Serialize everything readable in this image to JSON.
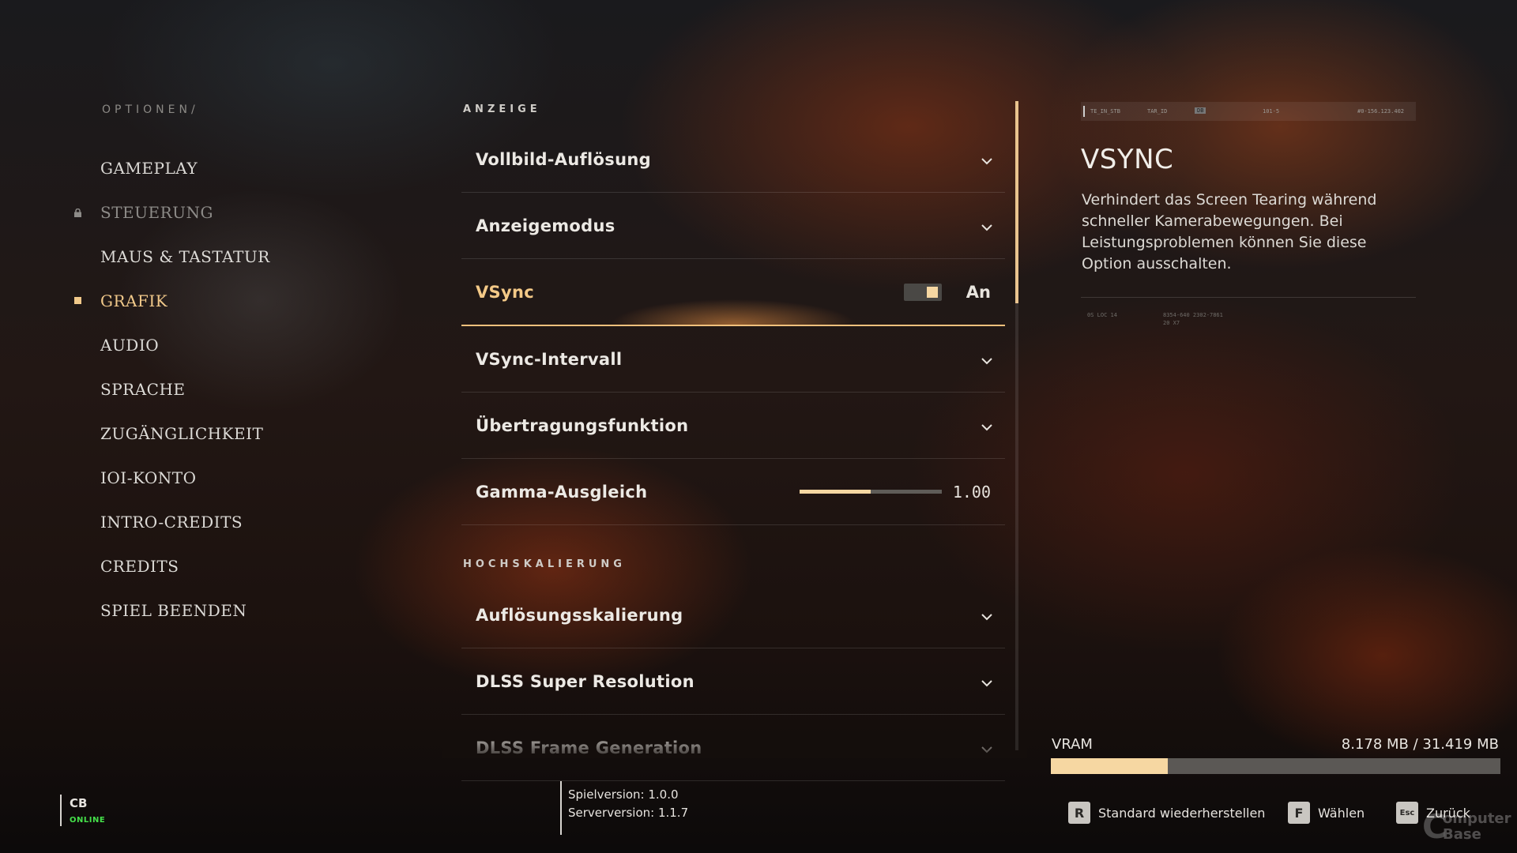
{
  "breadcrumb": "OPTIONEN/",
  "nav": {
    "items": [
      {
        "label": "GAMEPLAY",
        "state": "normal"
      },
      {
        "label": "STEUERUNG",
        "state": "locked",
        "icon": "lock-icon"
      },
      {
        "label": "MAUS & TASTATUR",
        "state": "normal"
      },
      {
        "label": "GRAFIK",
        "state": "active",
        "icon": "square-marker-icon"
      },
      {
        "label": "AUDIO",
        "state": "normal"
      },
      {
        "label": "SPRACHE",
        "state": "normal"
      },
      {
        "label": "ZUGÄNGLICHKEIT",
        "state": "normal"
      },
      {
        "label": "IOI-KONTO",
        "state": "normal"
      },
      {
        "label": "INTRO-CREDITS",
        "state": "normal"
      },
      {
        "label": "CREDITS",
        "state": "normal"
      },
      {
        "label": "SPIEL BEENDEN",
        "state": "normal"
      }
    ]
  },
  "sections": {
    "display": {
      "title": "ANZEIGE",
      "settings": [
        {
          "label": "Vollbild-Auflösung",
          "control": "dropdown"
        },
        {
          "label": "Anzeigemodus",
          "control": "dropdown"
        },
        {
          "label": "VSync",
          "control": "toggle",
          "value": "An",
          "on": true,
          "selected": true
        },
        {
          "label": "VSync-Intervall",
          "control": "dropdown"
        },
        {
          "label": "Übertragungsfunktion",
          "control": "dropdown"
        },
        {
          "label": "Gamma-Ausgleich",
          "control": "slider",
          "value": "1.00",
          "fraction": 0.5
        }
      ]
    },
    "upscaling": {
      "title": "HOCHSKALIERUNG",
      "settings": [
        {
          "label": "Auflösungsskalierung",
          "control": "dropdown"
        },
        {
          "label": "DLSS Super Resolution",
          "control": "dropdown"
        },
        {
          "label": "DLSS Frame Generation",
          "control": "dropdown"
        }
      ]
    }
  },
  "info": {
    "title": "VSYNC",
    "description": "Verhindert das Screen Tearing während schneller Kamerabewegungen. Bei Leistungsproblemen können Sie diese Option ausschalten.",
    "hud_strip": [
      "TE_IN_STB",
      "TAR_ID",
      "DB",
      "101-5",
      "#0-156.123.402"
    ],
    "micro_text": [
      "0S LOC 14",
      "8354-640 2302-7861",
      "20 X7"
    ]
  },
  "vram": {
    "label": "VRAM",
    "value": "8.178 MB / 31.419 MB",
    "fraction": 0.26
  },
  "hints": [
    {
      "key": "R",
      "label": "Standard wiederherstellen"
    },
    {
      "key": "F",
      "label": "Wählen"
    },
    {
      "key": "Esc",
      "label": "Zurück"
    }
  ],
  "player": {
    "name": "CB",
    "status": "ONLINE"
  },
  "version": {
    "game": "Spielversion: 1.0.0",
    "server": "Serverversion: 1.1.7"
  },
  "watermark": {
    "line1": "omputer",
    "line2": "Base",
    "mark": "C"
  },
  "colors": {
    "accent": "#f1c98a",
    "online": "#45e04a",
    "bar_fill": "#f6d7a2"
  }
}
